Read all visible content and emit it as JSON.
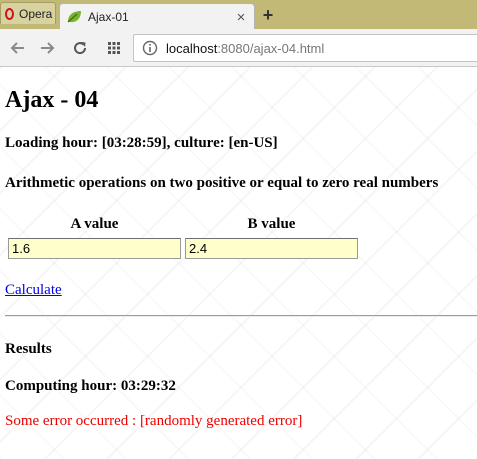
{
  "browser": {
    "tabs": [
      {
        "label": "Opera"
      },
      {
        "label": "Ajax-01"
      }
    ],
    "new_tab_symbol": "+",
    "close_symbol": "×",
    "address": {
      "host": "localhost",
      "rest": ":8080/ajax-04.html"
    },
    "icons": {
      "back": "arrow-left-icon",
      "forward": "arrow-right-icon",
      "reload": "reload-icon",
      "apps": "grid-icon",
      "site_info": "info-icon",
      "favicon": "leaf-icon"
    }
  },
  "page": {
    "title": "Ajax - 04",
    "loading_line": "Loading hour: [03:28:59], culture: [en-US]",
    "ops_heading": "Arithmetic operations on two positive or equal to zero real numbers",
    "form": {
      "a_label": "A value",
      "b_label": "B value",
      "a_value": "1.6",
      "b_value": "2.4"
    },
    "calculate_label": "Calculate",
    "results_heading": "Results",
    "computing_line": "Computing hour: 03:29:32",
    "error_line": "Some error occurred : [randomly generated error]"
  },
  "colors": {
    "tabbar": "#c2b977",
    "input_background": "#ffffcc",
    "link": "#0000ee",
    "error": "#ee0000"
  }
}
